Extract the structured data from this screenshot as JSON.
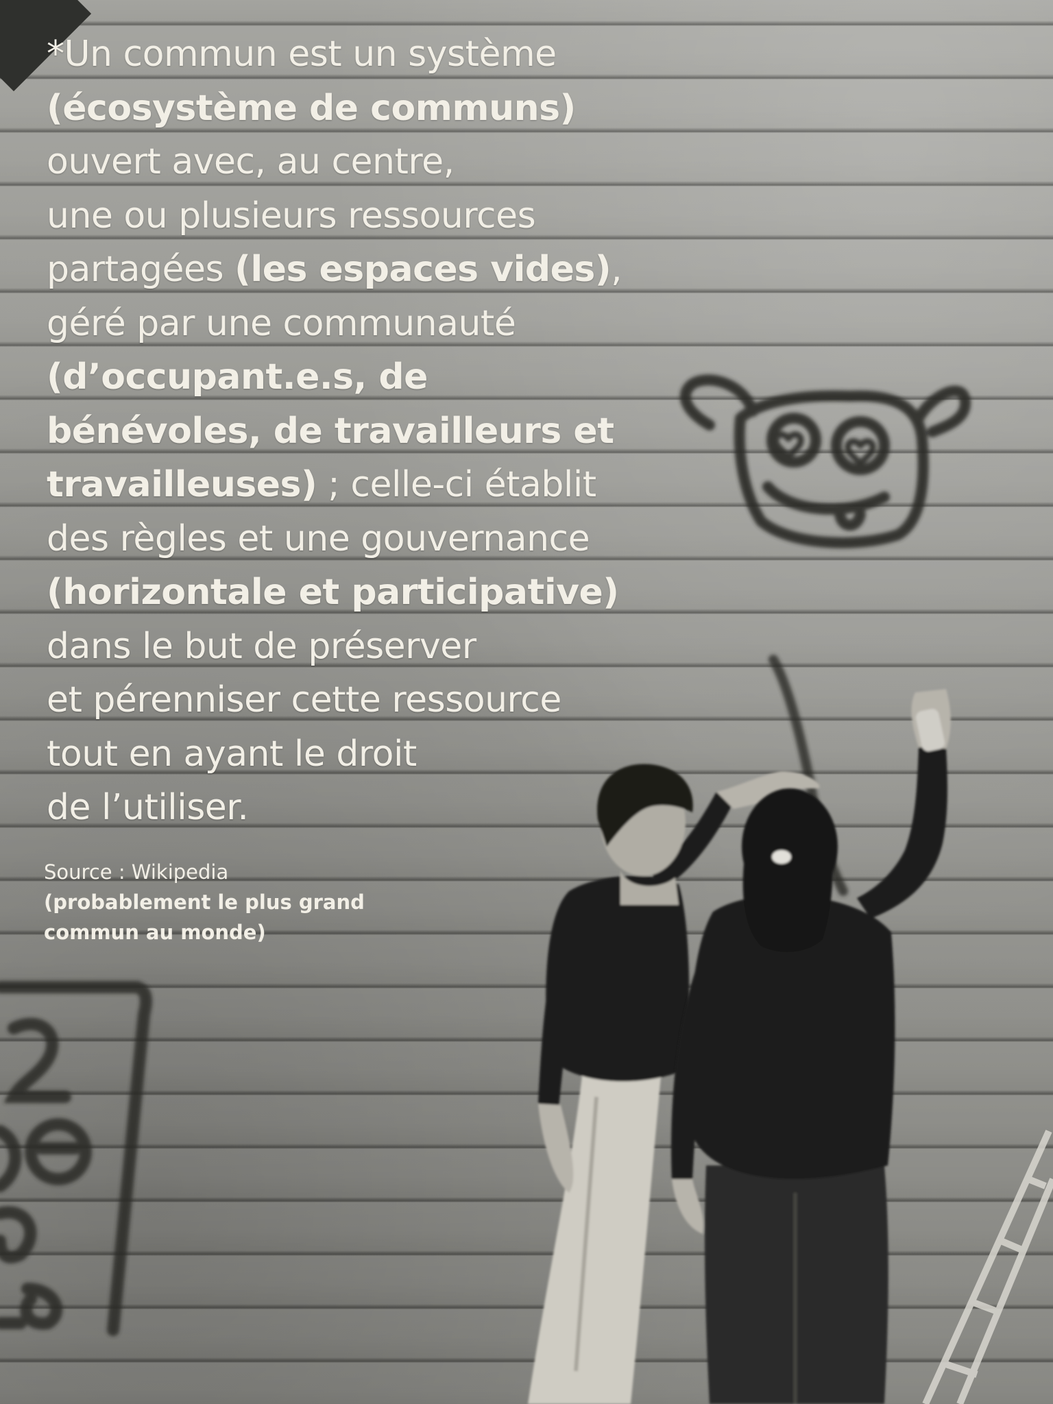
{
  "definition": {
    "line1": "*Un commun est un système",
    "line2_bold": "(écosystème de communs)",
    "line3": "ouvert avec, au centre,",
    "line4": "une ou plusieurs ressources",
    "line5_pre": "partagées ",
    "line5_bold": "(les espaces vides)",
    "line5_post": ",",
    "line6": "géré par une communauté",
    "line7_bold": "(d’occupant.e.s, de",
    "line8_bold": "bénévoles, de travailleurs et",
    "line9_bold": "travailleuses)",
    "line9_post": " ; celle-ci établit",
    "line10": "des règles et une gouvernance",
    "line11_bold": "(horizontale et participative)",
    "line12": "dans le but de préserver",
    "line13": "et pérenniser cette ressource",
    "line14": "tout en ayant le droit",
    "line15": "de l’utiliser."
  },
  "source": {
    "label": "Source : Wikipedia",
    "note_line1": "(probablement le plus grand",
    "note_line2": "commun au monde)"
  },
  "scene": {
    "description_colors": {
      "text": "#f2efe6",
      "wall": "#8f8f8b",
      "paint": "#2a2a28",
      "clothing": "#1c1c1b"
    }
  }
}
